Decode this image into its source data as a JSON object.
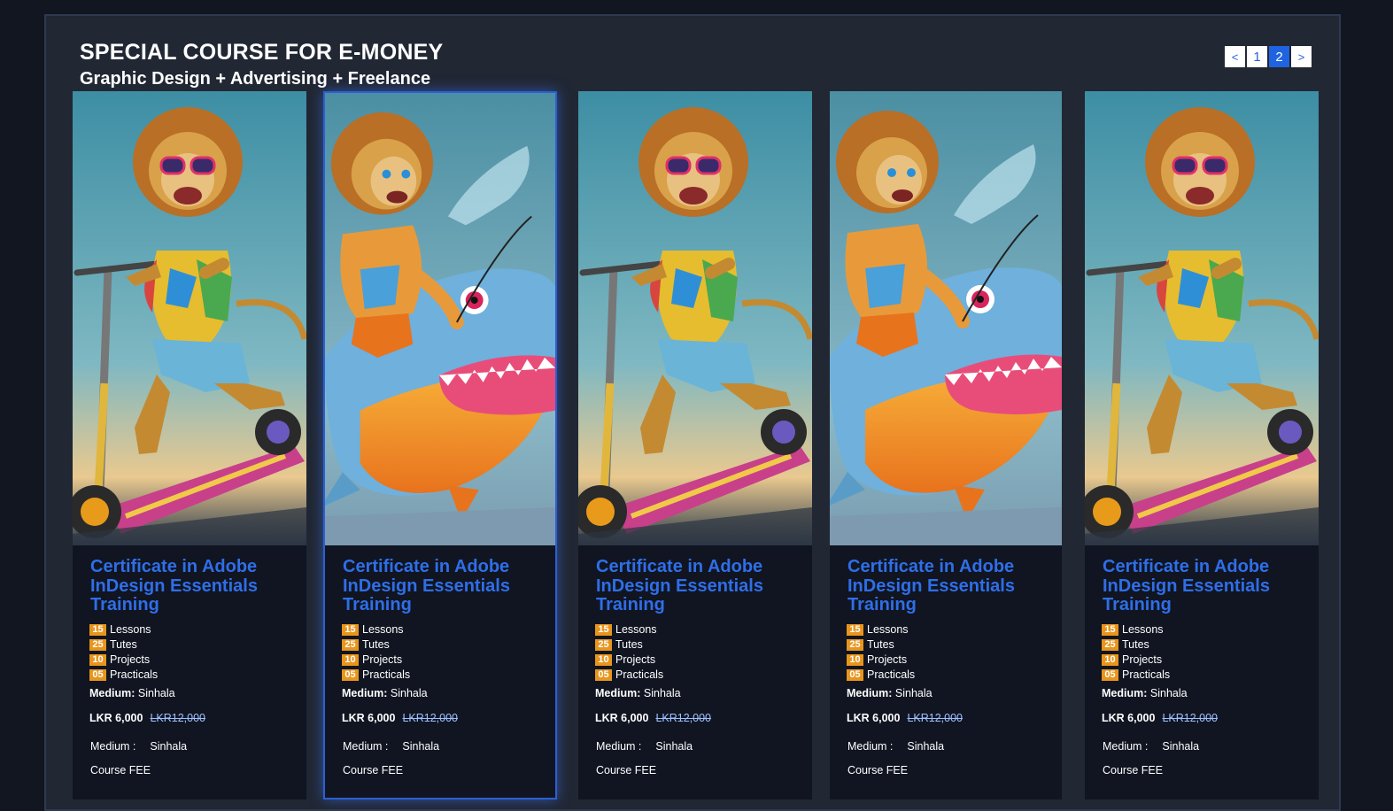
{
  "header": {
    "title": "SPECIAL COURSE FOR E-MONEY",
    "subtitle": "Graphic Design + Advertising + Freelance"
  },
  "pagination": {
    "prev": "<",
    "pages": [
      "1",
      "2"
    ],
    "active_page": "2",
    "next": ">"
  },
  "colors": {
    "accent": "#2f6ee8",
    "badge": "#e8951d",
    "background": "#111621",
    "panel": "#212733"
  },
  "cards": [
    {
      "image": "lion-on-scooter-illustration",
      "title": "Certificate in Adobe InDesign Essentials Training",
      "stats": [
        {
          "num": "15",
          "label": "Lessons"
        },
        {
          "num": "25",
          "label": "Tutes"
        },
        {
          "num": "10",
          "label": "Projects"
        },
        {
          "num": "05",
          "label": "Practicals"
        }
      ],
      "medium_label": "Medium:",
      "medium_value": "Sinhala",
      "price": "LKR 6,000",
      "old_price": "LKR12,000",
      "medium2_label": "Medium :",
      "medium2_value": "Sinhala",
      "fee_label": "Course FEE"
    },
    {
      "image": "lion-riding-shark-illustration",
      "title": "Certificate in Adobe InDesign Essentials Training",
      "stats": [
        {
          "num": "15",
          "label": "Lessons"
        },
        {
          "num": "25",
          "label": "Tutes"
        },
        {
          "num": "10",
          "label": "Projects"
        },
        {
          "num": "05",
          "label": "Practicals"
        }
      ],
      "medium_label": "Medium:",
      "medium_value": "Sinhala",
      "price": "LKR 6,000",
      "old_price": "LKR12,000",
      "medium2_label": "Medium :",
      "medium2_value": "Sinhala",
      "fee_label": "Course FEE"
    },
    {
      "image": "lion-on-scooter-illustration",
      "title": "Certificate in Adobe InDesign Essentials Training",
      "stats": [
        {
          "num": "15",
          "label": "Lessons"
        },
        {
          "num": "25",
          "label": "Tutes"
        },
        {
          "num": "10",
          "label": "Projects"
        },
        {
          "num": "05",
          "label": "Practicals"
        }
      ],
      "medium_label": "Medium:",
      "medium_value": "Sinhala",
      "price": "LKR 6,000",
      "old_price": "LKR12,000",
      "medium2_label": "Medium :",
      "medium2_value": "Sinhala",
      "fee_label": "Course FEE"
    },
    {
      "image": "lion-riding-shark-illustration",
      "title": "Certificate in Adobe InDesign Essentials Training",
      "stats": [
        {
          "num": "15",
          "label": "Lessons"
        },
        {
          "num": "25",
          "label": "Tutes"
        },
        {
          "num": "10",
          "label": "Projects"
        },
        {
          "num": "05",
          "label": "Practicals"
        }
      ],
      "medium_label": "Medium:",
      "medium_value": "Sinhala",
      "price": "LKR 6,000",
      "old_price": "LKR12,000",
      "medium2_label": "Medium :",
      "medium2_value": "Sinhala",
      "fee_label": "Course FEE"
    },
    {
      "image": "lion-on-scooter-illustration",
      "title": "Certificate in Adobe InDesign Essentials Training",
      "stats": [
        {
          "num": "15",
          "label": "Lessons"
        },
        {
          "num": "25",
          "label": "Tutes"
        },
        {
          "num": "10",
          "label": "Projects"
        },
        {
          "num": "05",
          "label": "Practicals"
        }
      ],
      "medium_label": "Medium:",
      "medium_value": "Sinhala",
      "price": "LKR 6,000",
      "old_price": "LKR12,000",
      "medium2_label": "Medium :",
      "medium2_value": "Sinhala",
      "fee_label": "Course FEE"
    }
  ]
}
